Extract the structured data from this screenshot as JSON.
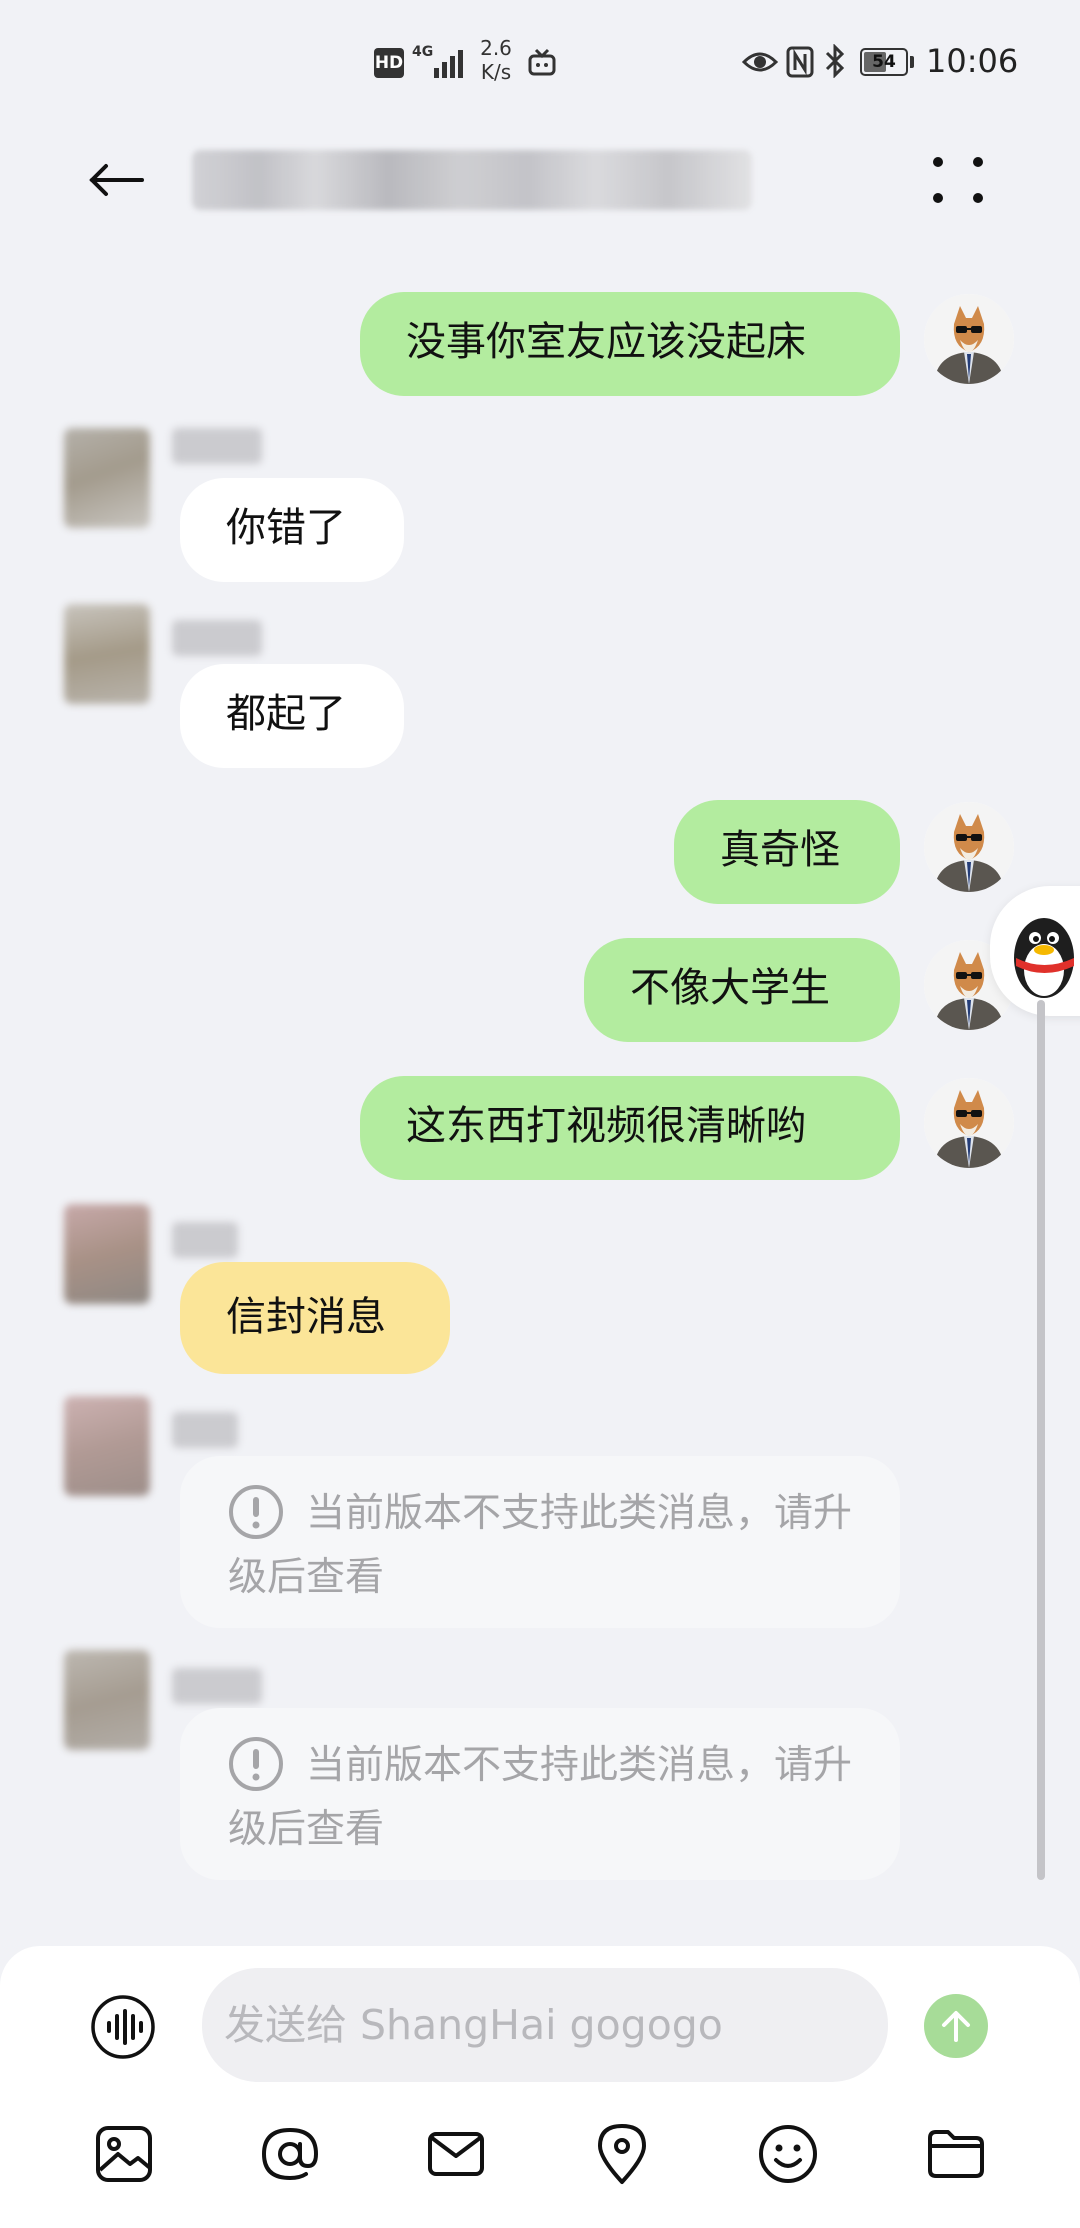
{
  "status_bar": {
    "hd": "HD",
    "network": "4G",
    "speed_value": "2.6",
    "speed_unit": "K/s",
    "battery": "54",
    "time": "10:06",
    "icons": [
      "hd-icon",
      "signal-icon",
      "tv-icon",
      "eye-icon",
      "nfc-icon",
      "bluetooth-icon",
      "battery-icon"
    ]
  },
  "header": {
    "back_icon": "back-icon",
    "more_icon": "more-icon"
  },
  "messages": [
    {
      "id": "m1",
      "direction": "out",
      "text": "没事你室友应该没起床"
    },
    {
      "id": "m2",
      "direction": "in",
      "text": "你错了"
    },
    {
      "id": "m3",
      "direction": "in",
      "text": "都起了"
    },
    {
      "id": "m4",
      "direction": "out",
      "text": "真奇怪"
    },
    {
      "id": "m5",
      "direction": "out",
      "text": "不像大学生"
    },
    {
      "id": "m6",
      "direction": "out",
      "text": "这东西打视频很清晰哟"
    },
    {
      "id": "m7",
      "direction": "in",
      "style": "envelope",
      "text": "信封消息"
    },
    {
      "id": "m8",
      "direction": "in",
      "style": "unsupported",
      "text": "当前版本不支持此类消息，请升级后查看"
    },
    {
      "id": "m9",
      "direction": "in",
      "style": "unsupported",
      "text": "当前版本不支持此类消息，请升级后查看"
    }
  ],
  "input": {
    "placeholder": "发送给 ShangHai gogogo",
    "value": ""
  },
  "toolbar": {
    "items": [
      "image-icon",
      "at-icon",
      "envelope-icon",
      "location-icon",
      "emoji-icon",
      "folder-icon"
    ]
  },
  "colors": {
    "background": "#f1f2f6",
    "outgoing_bubble": "#b3ec9f",
    "incoming_bubble": "#ffffff",
    "envelope_bubble": "#fbe598",
    "send_button": "#a7dc98"
  }
}
